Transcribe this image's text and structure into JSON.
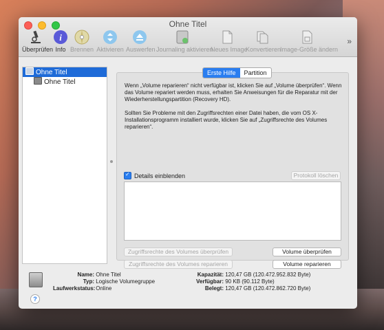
{
  "window": {
    "title": "Ohne Titel"
  },
  "toolbar": {
    "items": [
      {
        "label": "Überprüfen",
        "icon": "microscope-icon"
      },
      {
        "label": "Info",
        "icon": "info-icon"
      },
      {
        "label": "Brennen",
        "icon": "burn-disc-icon"
      },
      {
        "label": "Aktivieren",
        "icon": "mount-icon"
      },
      {
        "label": "Auswerfen",
        "icon": "eject-icon"
      },
      {
        "label": "Journaling aktivieren",
        "icon": "journaling-icon"
      },
      {
        "label": "Neues Image",
        "icon": "new-image-icon"
      },
      {
        "label": "Konvertieren",
        "icon": "convert-icon"
      },
      {
        "label": "Image-Größe ändern",
        "icon": "resize-image-icon"
      }
    ],
    "more": "»"
  },
  "sidebar": {
    "items": [
      {
        "label": "Ohne Titel"
      },
      {
        "label": "Ohne Titel"
      }
    ]
  },
  "tabs": {
    "first": "Erste Hilfe",
    "second": "Partition"
  },
  "help": {
    "p1": "Wenn „Volume reparieren“ nicht verfügbar ist, klicken Sie auf „Volume überprüfen“. Wenn das Volume repariert werden muss, erhalten Sie Anweisungen für die Reparatur mit der Wiederherstellungspartition (Recovery HD).",
    "p2": "Sollten Sie Probleme mit den Zugriffsrechten einer Datei haben, die vom OS X-Installationsprogramm installiert wurde, klicken Sie auf „Zugriffsrechte des Volumes reparieren“."
  },
  "details": {
    "label": "Details einblenden",
    "checked": true
  },
  "buttons": {
    "clear_log": "Protokoll löschen",
    "verify_permissions": "Zugriffsrechte des Volumes überprüfen",
    "repair_permissions": "Zugriffsrechte des Volumes reparieren",
    "verify_volume": "Volume überprüfen",
    "repair_volume": "Volume reparieren"
  },
  "info": {
    "name_k": "Name:",
    "name_v": "Ohne Titel",
    "type_k": "Typ:",
    "type_v": "Logische Volumegruppe",
    "status_k": "Laufwerkstatus:",
    "status_v": "Online",
    "cap_k": "Kapazität:",
    "cap_v": "120,47 GB (120.472.952.832 Byte)",
    "avail_k": "Verfügbar:",
    "avail_v": "90 KB (90.112 Byte)",
    "used_k": "Belegt:",
    "used_v": "120,47 GB (120.472.862.720 Byte)"
  },
  "help_button": "?"
}
